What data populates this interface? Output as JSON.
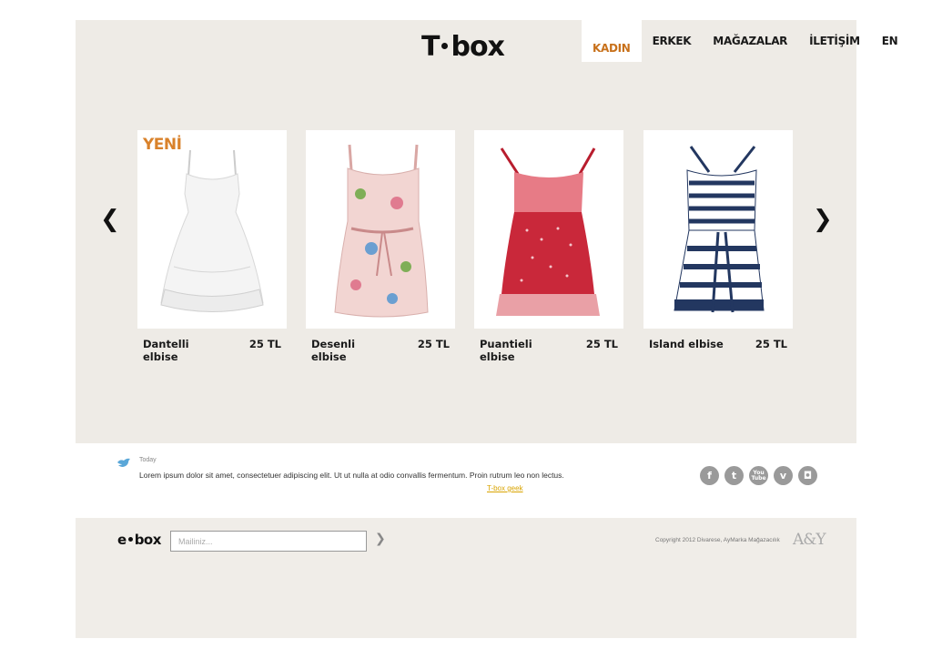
{
  "brand": {
    "logo_left": "T",
    "logo_right": "box"
  },
  "nav": {
    "items": [
      {
        "label": "KADIN",
        "active": true
      },
      {
        "label": "ERKEK",
        "active": false
      },
      {
        "label": "MAĞAZALAR",
        "active": false
      },
      {
        "label": "İLETİŞİM",
        "active": false
      },
      {
        "label": "EN",
        "active": false
      }
    ]
  },
  "carousel": {
    "prev_icon": "chevron-left-icon",
    "next_icon": "chevron-right-icon",
    "new_badge": "YENİ",
    "products": [
      {
        "name": "Dantelli elbise",
        "price": "25 TL",
        "image": "white-lace-dress",
        "color": "#f4f4f4"
      },
      {
        "name": "Desenli elbise",
        "price": "25 TL",
        "image": "floral-dress",
        "color": "#f2d5d2"
      },
      {
        "name": "Puantieli elbise",
        "price": "25 TL",
        "image": "red-polka-dot-dress",
        "color": "#c9283a"
      },
      {
        "name": "Island elbise",
        "price": "25 TL",
        "image": "navy-striped-dress",
        "color": "#233760"
      }
    ]
  },
  "twitter": {
    "icon": "twitter-bird-icon",
    "time": "Today",
    "text": "Lorem ipsum dolor sit amet, consectetuer adipiscing elit. Ut ut nulla at odio convallis fermentum. Proin rutrum leo non lectus.",
    "link": "T-box geek"
  },
  "social": [
    "f",
    "t",
    "You Tube",
    "v",
    "◘"
  ],
  "footer": {
    "ebox_left": "e",
    "ebox_right": "box",
    "mail_placeholder": "Mailiniz...",
    "submit_icon": "chevron-right-icon",
    "copyright": "Copyright 2012 Divarese, AyMarka Mağazacılık",
    "partner_logo": "A&Y"
  }
}
